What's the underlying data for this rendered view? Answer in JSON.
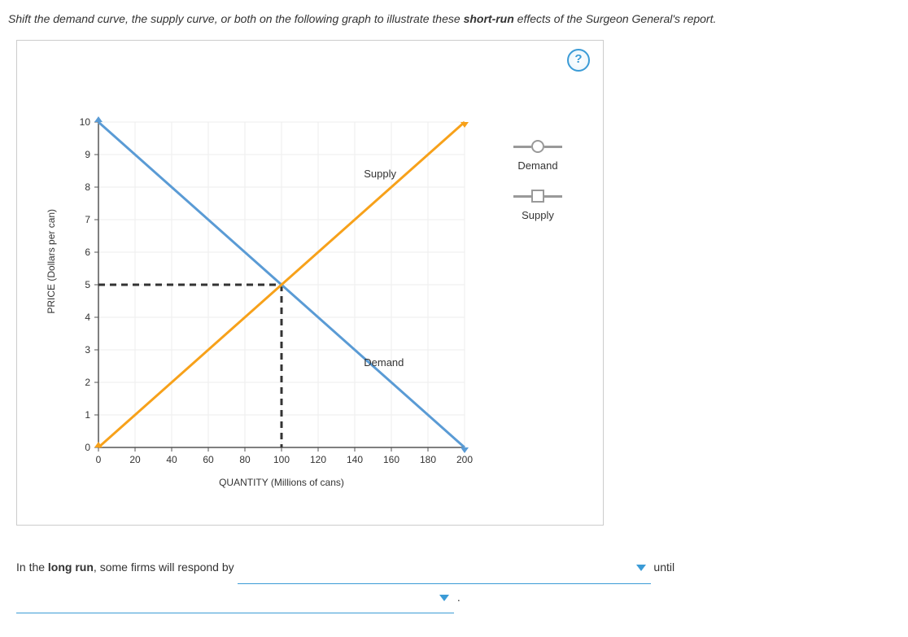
{
  "instruction": {
    "pre": "Shift the demand curve, the supply curve, or both on the following graph to illustrate these ",
    "bold": "short-run",
    "post": " effects of the Surgeon General's report."
  },
  "help_tooltip": "?",
  "legend": {
    "demand_label": "Demand",
    "supply_label": "Supply"
  },
  "chart_data": {
    "type": "line",
    "xlabel": "QUANTITY (Millions of cans)",
    "ylabel": "PRICE (Dollars per can)",
    "xlim": [
      0,
      200
    ],
    "ylim": [
      0,
      10
    ],
    "x_ticks": [
      0,
      20,
      40,
      60,
      80,
      100,
      120,
      140,
      160,
      180,
      200
    ],
    "y_ticks": [
      0,
      1,
      2,
      3,
      4,
      5,
      6,
      7,
      8,
      9,
      10
    ],
    "series": [
      {
        "name": "Demand",
        "color": "#5a9bd5",
        "points": [
          [
            0,
            10
          ],
          [
            200,
            0
          ]
        ]
      },
      {
        "name": "Supply",
        "color": "#f7a11a",
        "points": [
          [
            0,
            0
          ],
          [
            200,
            10
          ]
        ]
      }
    ],
    "equilibrium": {
      "x": 100,
      "y": 5
    },
    "curve_labels": {
      "supply": {
        "text": "Supply",
        "at": [
          145,
          8.3
        ]
      },
      "demand": {
        "text": "Demand",
        "at": [
          145,
          2.5
        ]
      }
    }
  },
  "sentence": {
    "part1_pre": "In the ",
    "part1_bold": "long run",
    "part1_post": ", some firms will respond by ",
    "dropdown1_value": "",
    "after1": " until",
    "dropdown2_value": "",
    "period": "."
  }
}
